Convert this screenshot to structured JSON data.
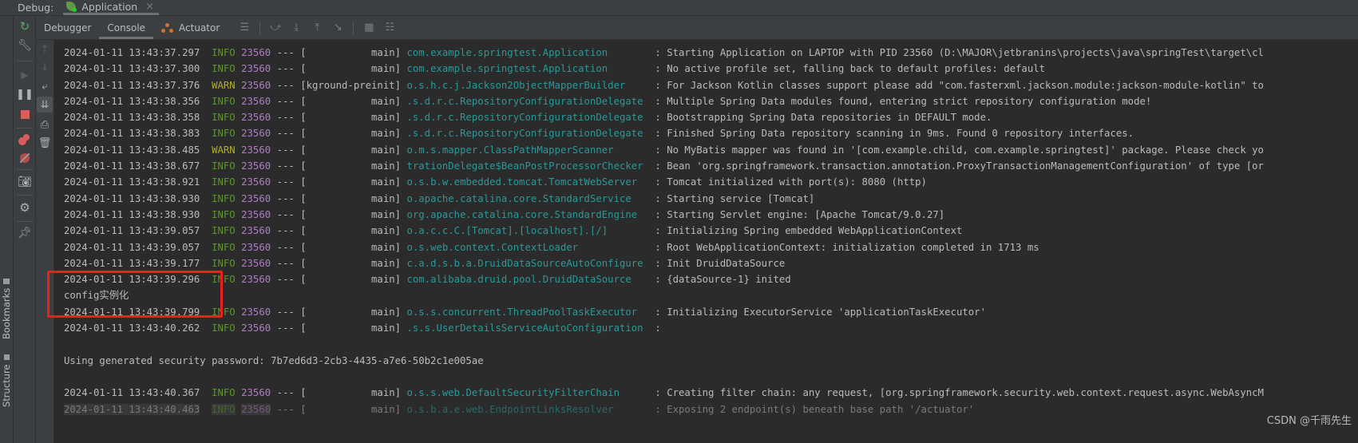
{
  "topbar": {
    "debug_label": "Debug:",
    "run_tab": "Application",
    "close_symbol": "×"
  },
  "left_strip": {
    "bookmarks": "Bookmarks",
    "structure": "Structure"
  },
  "tabs": [
    {
      "label": "Debugger",
      "active": false
    },
    {
      "label": "Console",
      "active": true
    },
    {
      "label": "Actuator",
      "active": false
    }
  ],
  "tab_toolbar_icons": [
    "menu-icon",
    "show-execution-point-icon",
    "step-over-icon",
    "step-into-icon",
    "step-out-icon",
    "run-to-cursor-icon",
    "evaluate-expression-icon",
    "trace-current-stream-icon"
  ],
  "debug_toolbar_icons": [
    "rerun-icon",
    "settings-wrench-icon",
    "resume-icon",
    "pause-icon",
    "stop-icon",
    "view-breakpoints-icon",
    "mute-breakpoints-icon",
    "get-thread-dump-icon",
    "settings-gear-icon",
    "pin-tab-icon"
  ],
  "console_toolbar_icons": [
    "up-arrow-icon",
    "down-arrow-icon",
    "soft-wrap-icon",
    "scroll-to-end-icon",
    "print-icon",
    "clear-all-icon"
  ],
  "console": {
    "lines": [
      {
        "type": "log",
        "ts": "2024-01-11 13:43:37.297",
        "level": "INFO",
        "pid": "23560",
        "sep": "---",
        "thread": "[           main]",
        "logger": "com.example.springtest.Application       ",
        "msg": ": Starting Application on LAPTOP with PID 23560 (D:\\MAJOR\\jetbranins\\projects\\java\\springTest\\target\\cl"
      },
      {
        "type": "log",
        "ts": "2024-01-11 13:43:37.300",
        "level": "INFO",
        "pid": "23560",
        "sep": "---",
        "thread": "[           main]",
        "logger": "com.example.springtest.Application       ",
        "msg": ": No active profile set, falling back to default profiles: default"
      },
      {
        "type": "log",
        "ts": "2024-01-11 13:43:37.376",
        "level": "WARN",
        "pid": "23560",
        "sep": "---",
        "thread": "[kground-preinit]",
        "logger": "o.s.h.c.j.Jackson2ObjectMapperBuilder    ",
        "msg": ": For Jackson Kotlin classes support please add \"com.fasterxml.jackson.module:jackson-module-kotlin\" to"
      },
      {
        "type": "log",
        "ts": "2024-01-11 13:43:38.356",
        "level": "INFO",
        "pid": "23560",
        "sep": "---",
        "thread": "[           main]",
        "logger": ".s.d.r.c.RepositoryConfigurationDelegate ",
        "msg": ": Multiple Spring Data modules found, entering strict repository configuration mode!"
      },
      {
        "type": "log",
        "ts": "2024-01-11 13:43:38.358",
        "level": "INFO",
        "pid": "23560",
        "sep": "---",
        "thread": "[           main]",
        "logger": ".s.d.r.c.RepositoryConfigurationDelegate ",
        "msg": ": Bootstrapping Spring Data repositories in DEFAULT mode."
      },
      {
        "type": "log",
        "ts": "2024-01-11 13:43:38.383",
        "level": "INFO",
        "pid": "23560",
        "sep": "---",
        "thread": "[           main]",
        "logger": ".s.d.r.c.RepositoryConfigurationDelegate ",
        "msg": ": Finished Spring Data repository scanning in 9ms. Found 0 repository interfaces."
      },
      {
        "type": "log",
        "ts": "2024-01-11 13:43:38.485",
        "level": "WARN",
        "pid": "23560",
        "sep": "---",
        "thread": "[           main]",
        "logger": "o.m.s.mapper.ClassPathMapperScanner      ",
        "msg": ": No MyBatis mapper was found in '[com.example.child, com.example.springtest]' package. Please check yo"
      },
      {
        "type": "log",
        "ts": "2024-01-11 13:43:38.677",
        "level": "INFO",
        "pid": "23560",
        "sep": "---",
        "thread": "[           main]",
        "logger": "trationDelegate$BeanPostProcessorChecker ",
        "msg": ": Bean 'org.springframework.transaction.annotation.ProxyTransactionManagementConfiguration' of type [or"
      },
      {
        "type": "log",
        "ts": "2024-01-11 13:43:38.921",
        "level": "INFO",
        "pid": "23560",
        "sep": "---",
        "thread": "[           main]",
        "logger": "o.s.b.w.embedded.tomcat.TomcatWebServer  ",
        "msg": ": Tomcat initialized with port(s): 8080 (http)"
      },
      {
        "type": "log",
        "ts": "2024-01-11 13:43:38.930",
        "level": "INFO",
        "pid": "23560",
        "sep": "---",
        "thread": "[           main]",
        "logger": "o.apache.catalina.core.StandardService   ",
        "msg": ": Starting service [Tomcat]"
      },
      {
        "type": "log",
        "ts": "2024-01-11 13:43:38.930",
        "level": "INFO",
        "pid": "23560",
        "sep": "---",
        "thread": "[           main]",
        "logger": "org.apache.catalina.core.StandardEngine  ",
        "msg": ": Starting Servlet engine: [Apache Tomcat/9.0.27]"
      },
      {
        "type": "log",
        "ts": "2024-01-11 13:43:39.057",
        "level": "INFO",
        "pid": "23560",
        "sep": "---",
        "thread": "[           main]",
        "logger": "o.a.c.c.C.[Tomcat].[localhost].[/]       ",
        "msg": ": Initializing Spring embedded WebApplicationContext"
      },
      {
        "type": "log",
        "ts": "2024-01-11 13:43:39.057",
        "level": "INFO",
        "pid": "23560",
        "sep": "---",
        "thread": "[           main]",
        "logger": "o.s.web.context.ContextLoader            ",
        "msg": ": Root WebApplicationContext: initialization completed in 1713 ms"
      },
      {
        "type": "log",
        "ts": "2024-01-11 13:43:39.177",
        "level": "INFO",
        "pid": "23560",
        "sep": "---",
        "thread": "[           main]",
        "logger": "c.a.d.s.b.a.DruidDataSourceAutoConfigure ",
        "msg": ": Init DruidDataSource"
      },
      {
        "type": "log",
        "ts": "2024-01-11 13:43:39.296",
        "level": "INFO",
        "pid": "23560",
        "sep": "---",
        "thread": "[           main]",
        "logger": "com.alibaba.druid.pool.DruidDataSource   ",
        "msg": ": {dataSource-1} inited"
      },
      {
        "type": "plain",
        "text": "config实例化"
      },
      {
        "type": "log",
        "ts": "2024-01-11 13:43:39.799",
        "level": "INFO",
        "pid": "23560",
        "sep": "---",
        "thread": "[           main]",
        "logger": "o.s.s.concurrent.ThreadPoolTaskExecutor  ",
        "msg": ": Initializing ExecutorService 'applicationTaskExecutor'"
      },
      {
        "type": "log",
        "ts": "2024-01-11 13:43:40.262",
        "level": "INFO",
        "pid": "23560",
        "sep": "---",
        "thread": "[           main]",
        "logger": ".s.s.UserDetailsServiceAutoConfiguration ",
        "msg": ":"
      },
      {
        "type": "plain",
        "text": ""
      },
      {
        "type": "plain",
        "text": "Using generated security password: 7b7ed6d3-2cb3-4435-a7e6-50b2c1e005ae"
      },
      {
        "type": "plain",
        "text": ""
      },
      {
        "type": "log",
        "ts": "2024-01-11 13:43:40.367",
        "level": "INFO",
        "pid": "23560",
        "sep": "---",
        "thread": "[           main]",
        "logger": "o.s.s.web.DefaultSecurityFilterChain     ",
        "msg": ": Creating filter chain: any request, [org.springframework.security.web.context.request.async.WebAsyncM"
      },
      {
        "type": "log",
        "faded": true,
        "ts": "2024-01-11 13:43:40.463",
        "level": "INFO",
        "pid": "23560",
        "sep": "---",
        "thread": "[           main]",
        "logger": "o.s.b.a.e.web.EndpointLinksResolver      ",
        "msg": ": Exposing 2 endpoint(s) beneath base path '/actuator'"
      }
    ]
  },
  "watermark": "CSDN @千雨先生",
  "colors": {
    "info": "#5c962c",
    "warn": "#b3ae20",
    "pid": "#b07cc6",
    "logger": "#299999",
    "text": "#bbbbbb",
    "highlight_box": "#e8211a",
    "stop": "#db5c5c"
  }
}
